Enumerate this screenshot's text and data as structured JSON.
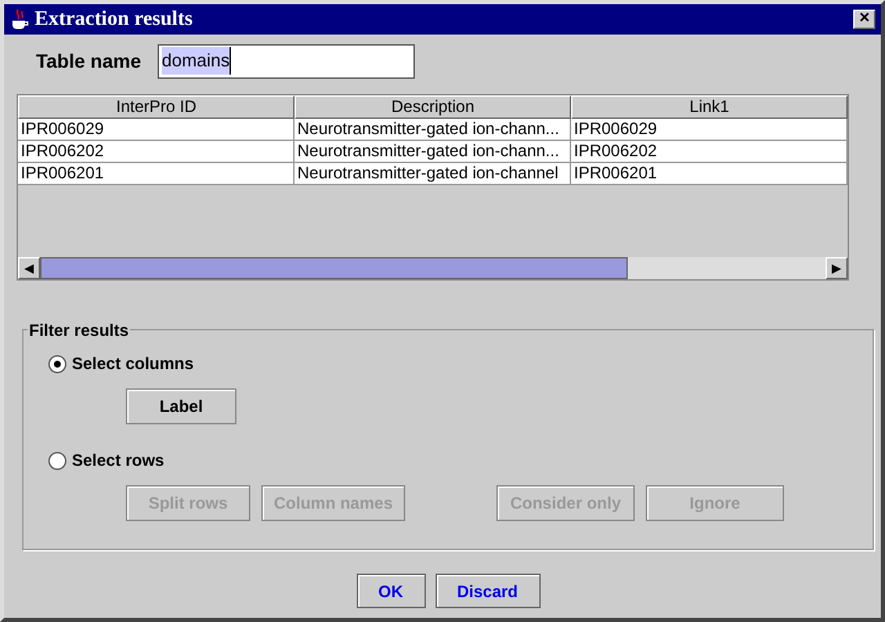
{
  "window": {
    "title": "Extraction results",
    "close": "✕"
  },
  "table_name": {
    "label": "Table name",
    "value": "domains"
  },
  "table": {
    "columns": [
      "InterPro ID",
      "Description",
      "Link1"
    ],
    "rows": [
      [
        "IPR006029",
        "Neurotransmitter-gated ion-chann...",
        "IPR006029"
      ],
      [
        "IPR006202",
        "Neurotransmitter-gated ion-chann...",
        "IPR006202"
      ],
      [
        "IPR006201",
        "Neurotransmitter-gated ion-channel",
        "IPR006201"
      ]
    ],
    "scroll_left": "◀",
    "scroll_right": "▶"
  },
  "filter": {
    "title": "Filter results",
    "options": [
      {
        "label": "Select columns",
        "selected": true,
        "buttons": [
          {
            "label": "Label",
            "disabled": false
          }
        ]
      },
      {
        "label": "Select rows",
        "selected": false,
        "buttons": [
          {
            "label": "Split rows",
            "disabled": true
          },
          {
            "label": "Column names",
            "disabled": true
          },
          {
            "label": "Consider only",
            "disabled": true
          },
          {
            "label": "Ignore",
            "disabled": true
          }
        ]
      }
    ]
  },
  "buttons": [
    {
      "label": "OK"
    },
    {
      "label": "Discard"
    }
  ]
}
